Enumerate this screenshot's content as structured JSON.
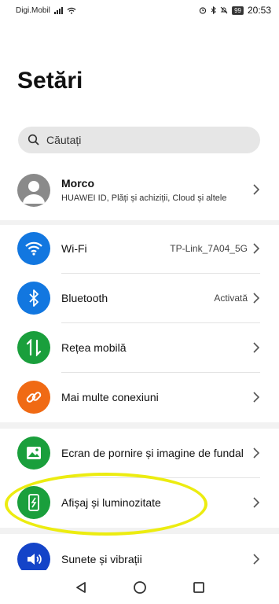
{
  "status_bar": {
    "carrier": "Digi.Mobil",
    "battery": "99",
    "time": "20:53"
  },
  "title": "Setări",
  "search": {
    "placeholder": "Căutați"
  },
  "account": {
    "name": "Morco",
    "subtitle": "HUAWEI ID, Plăți și achiziții, Cloud și altele"
  },
  "settings": [
    {
      "label": "Wi-Fi",
      "value": "TP-Link_7A04_5G",
      "icon": "wifi-icon",
      "color": "#1277e0"
    },
    {
      "label": "Bluetooth",
      "value": "Activată",
      "icon": "bluetooth-icon",
      "color": "#1277e0"
    },
    {
      "label": "Rețea mobilă",
      "value": "",
      "icon": "mobile-network-icon",
      "color": "#1a9f3c"
    },
    {
      "label": "Mai multe conexiuni",
      "value": "",
      "icon": "link-icon",
      "color": "#f06a14"
    },
    {
      "label": "Ecran de pornire și imagine de fundal",
      "value": "",
      "icon": "wallpaper-icon",
      "color": "#1a9f3c"
    },
    {
      "label": "Afișaj și luminozitate",
      "value": "",
      "icon": "display-icon",
      "color": "#1a9f3c"
    },
    {
      "label": "Sunete și vibrații",
      "value": "",
      "icon": "sound-icon",
      "color": "#1444c8"
    }
  ],
  "highlight_color": "#ecec10"
}
